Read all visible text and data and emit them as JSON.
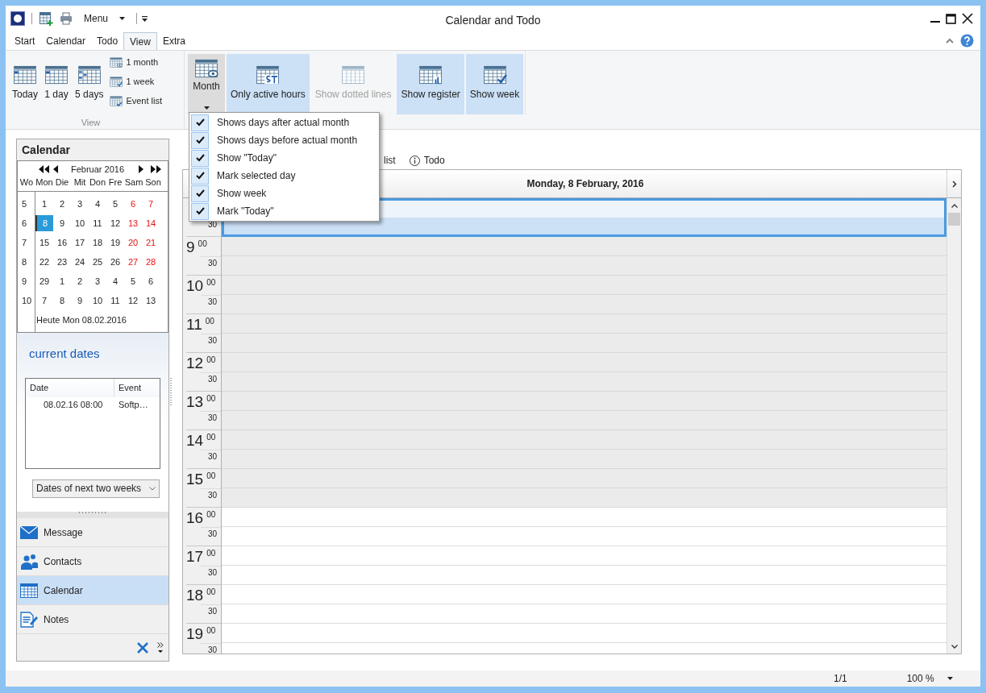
{
  "window": {
    "title": "Calendar and Todo"
  },
  "quick_access": {
    "menu_label": "Menu"
  },
  "tabs": [
    {
      "label": "Start",
      "selected": false
    },
    {
      "label": "Calendar",
      "selected": false
    },
    {
      "label": "Todo",
      "selected": false
    },
    {
      "label": "View",
      "selected": true
    },
    {
      "label": "Extra",
      "selected": false
    }
  ],
  "ribbon": {
    "view_group": {
      "label": "View",
      "large_buttons": [
        {
          "label": "Today",
          "kind": "today"
        },
        {
          "label": "1 day",
          "kind": "day"
        },
        {
          "label": "5 days",
          "kind": "days"
        }
      ],
      "small_buttons": [
        {
          "label": "1 month",
          "kind": "month"
        },
        {
          "label": "1 week",
          "kind": "week"
        },
        {
          "label": "Event list",
          "kind": "list"
        }
      ]
    },
    "toggles": [
      {
        "label": "Month",
        "kind": "month",
        "expanded": true
      },
      {
        "label": "Only active hours",
        "kind": "active",
        "on": true,
        "disabled": false
      },
      {
        "label": "Show dotted lines",
        "kind": "dotted",
        "on": false,
        "disabled": true
      },
      {
        "label": "Show register",
        "kind": "register",
        "on": true,
        "disabled": false
      },
      {
        "label": "Show week",
        "kind": "week",
        "on": true,
        "disabled": false
      }
    ]
  },
  "dropdown_menu": [
    {
      "label": "Shows days after actual month",
      "checked": true
    },
    {
      "label": "Shows days before actual month",
      "checked": true
    },
    {
      "label": "Show \"Today\"",
      "checked": true
    },
    {
      "label": "Mark selected day",
      "checked": true
    },
    {
      "label": "Show week",
      "checked": true
    },
    {
      "label": "Mark \"Today\"",
      "checked": true
    }
  ],
  "sidebar": {
    "title": "Calendar",
    "mini_calendar": {
      "month": "Februar 2016",
      "headers": [
        "Wo",
        "Mon",
        "Die",
        "Mit",
        "Don",
        "Fre",
        "Sam",
        "Son"
      ],
      "weeks": [
        {
          "week": "5",
          "days": [
            {
              "text": "1",
              "weekend": false,
              "selected": false
            },
            {
              "text": "2",
              "weekend": false,
              "selected": false
            },
            {
              "text": "3",
              "weekend": false,
              "selected": false
            },
            {
              "text": "4",
              "weekend": false,
              "selected": false
            },
            {
              "text": "5",
              "weekend": false,
              "selected": false
            },
            {
              "text": "6",
              "weekend": true,
              "selected": false
            },
            {
              "text": "7",
              "weekend": true,
              "selected": false
            }
          ]
        },
        {
          "week": "6",
          "days": [
            {
              "text": "8",
              "weekend": false,
              "selected": true
            },
            {
              "text": "9",
              "weekend": false,
              "selected": false
            },
            {
              "text": "10",
              "weekend": false,
              "selected": false
            },
            {
              "text": "11",
              "weekend": false,
              "selected": false
            },
            {
              "text": "12",
              "weekend": false,
              "selected": false
            },
            {
              "text": "13",
              "weekend": true,
              "selected": false
            },
            {
              "text": "14",
              "weekend": true,
              "selected": false
            }
          ]
        },
        {
          "week": "7",
          "days": [
            {
              "text": "15",
              "weekend": false,
              "selected": false
            },
            {
              "text": "16",
              "weekend": false,
              "selected": false
            },
            {
              "text": "17",
              "weekend": false,
              "selected": false
            },
            {
              "text": "18",
              "weekend": false,
              "selected": false
            },
            {
              "text": "19",
              "weekend": false,
              "selected": false
            },
            {
              "text": "20",
              "weekend": true,
              "selected": false
            },
            {
              "text": "21",
              "weekend": true,
              "selected": false
            }
          ]
        },
        {
          "week": "8",
          "days": [
            {
              "text": "22",
              "weekend": false,
              "selected": false
            },
            {
              "text": "23",
              "weekend": false,
              "selected": false
            },
            {
              "text": "24",
              "weekend": false,
              "selected": false
            },
            {
              "text": "25",
              "weekend": false,
              "selected": false
            },
            {
              "text": "26",
              "weekend": false,
              "selected": false
            },
            {
              "text": "27",
              "weekend": true,
              "selected": false
            },
            {
              "text": "28",
              "weekend": true,
              "selected": false
            }
          ]
        },
        {
          "week": "9",
          "days": [
            {
              "text": "29",
              "weekend": false,
              "selected": false
            },
            {
              "text": "1",
              "weekend": false,
              "selected": false
            },
            {
              "text": "2",
              "weekend": false,
              "selected": false
            },
            {
              "text": "3",
              "weekend": false,
              "selected": false
            },
            {
              "text": "4",
              "weekend": false,
              "selected": false
            },
            {
              "text": "5",
              "weekend": false,
              "selected": false
            },
            {
              "text": "6",
              "weekend": false,
              "selected": false
            }
          ]
        },
        {
          "week": "10",
          "days": [
            {
              "text": "7",
              "weekend": false,
              "selected": false
            },
            {
              "text": "8",
              "weekend": false,
              "selected": false
            },
            {
              "text": "9",
              "weekend": false,
              "selected": false
            },
            {
              "text": "10",
              "weekend": false,
              "selected": false
            },
            {
              "text": "11",
              "weekend": false,
              "selected": false
            },
            {
              "text": "12",
              "weekend": false,
              "selected": false
            },
            {
              "text": "13",
              "weekend": false,
              "selected": false
            }
          ]
        }
      ],
      "today": "Heute Mon 08.02.2016"
    },
    "current_dates": {
      "title": "current dates",
      "columns": [
        "Date",
        "Event"
      ],
      "rows": [
        [
          "08.02.16 08:00",
          "Softp…"
        ]
      ],
      "filter": "Dates of next two weeks"
    },
    "nav_items": [
      {
        "label": "Message",
        "kind": "mail",
        "selected": false
      },
      {
        "label": "Contacts",
        "kind": "contacts",
        "selected": false
      },
      {
        "label": "Calendar",
        "kind": "calendar",
        "selected": true
      },
      {
        "label": "Notes",
        "kind": "notes",
        "selected": false
      }
    ]
  },
  "main": {
    "view_tabs": [
      {
        "label": "list",
        "kind": "plain"
      },
      {
        "label": "Todo",
        "kind": "info"
      }
    ],
    "day_header": "Monday, 8 February, 2016",
    "hours": [
      {
        "bottom_minute": "30",
        "slots": [
          {
            "kind": "selected"
          },
          {
            "kind": "selected"
          }
        ]
      },
      {
        "hour": "9",
        "top_minute": "00",
        "bottom_minute": "30",
        "slots": [
          {
            "kind": "shaded"
          },
          {
            "kind": "shaded"
          }
        ]
      },
      {
        "hour": "10",
        "top_minute": "00",
        "bottom_minute": "30",
        "slots": [
          {
            "kind": "shaded"
          },
          {
            "kind": "shaded"
          }
        ]
      },
      {
        "hour": "11",
        "top_minute": "00",
        "bottom_minute": "30",
        "slots": [
          {
            "kind": "shaded"
          },
          {
            "kind": "shaded"
          }
        ]
      },
      {
        "hour": "12",
        "top_minute": "00",
        "bottom_minute": "30",
        "slots": [
          {
            "kind": "shaded"
          },
          {
            "kind": "shaded"
          }
        ]
      },
      {
        "hour": "13",
        "top_minute": "00",
        "bottom_minute": "30",
        "slots": [
          {
            "kind": "shaded"
          },
          {
            "kind": "shaded"
          }
        ]
      },
      {
        "hour": "14",
        "top_minute": "00",
        "bottom_minute": "30",
        "slots": [
          {
            "kind": "shaded"
          },
          {
            "kind": "shaded"
          }
        ]
      },
      {
        "hour": "15",
        "top_minute": "00",
        "bottom_minute": "30",
        "slots": [
          {
            "kind": "shaded"
          },
          {
            "kind": "shaded"
          }
        ]
      },
      {
        "hour": "16",
        "top_minute": "00",
        "bottom_minute": "30",
        "slots": [
          {
            "kind": "free"
          },
          {
            "kind": "free"
          }
        ]
      },
      {
        "hour": "17",
        "top_minute": "00",
        "bottom_minute": "30",
        "slots": [
          {
            "kind": "free"
          },
          {
            "kind": "free"
          }
        ]
      },
      {
        "hour": "18",
        "top_minute": "00",
        "bottom_minute": "30",
        "slots": [
          {
            "kind": "free"
          },
          {
            "kind": "free"
          }
        ]
      },
      {
        "hour": "19",
        "top_minute": "00",
        "bottom_minute": "30",
        "slots": [
          {
            "kind": "free"
          },
          {
            "kind": "free"
          }
        ]
      }
    ]
  },
  "status_bar": {
    "page": "1/1",
    "zoom": "100 %"
  }
}
